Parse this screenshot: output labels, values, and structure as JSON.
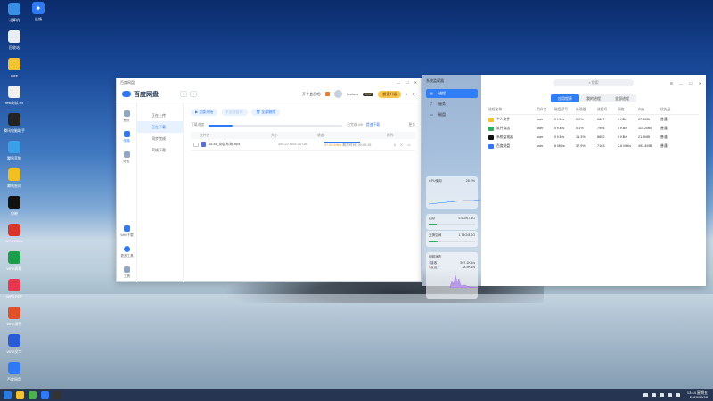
{
  "desktop": {
    "icons": [
      {
        "label": "计算机",
        "icon": "computer-icon",
        "color": "#3a8ee6"
      },
      {
        "label": "回收站",
        "icon": "trash-icon",
        "color": "#e8eef4"
      },
      {
        "label": "core",
        "icon": "folder-icon",
        "color": "#f2c230"
      },
      {
        "label": "test测试.txt",
        "icon": "text-file-icon",
        "color": "#f0f0f0"
      },
      {
        "label": "腾讯电脑助手",
        "icon": "qq-assistant-icon",
        "color": "#222222"
      },
      {
        "label": "腾讯蓝鲸",
        "icon": "ring-icon",
        "color": "#3aa0e8"
      },
      {
        "label": "腾讯智问",
        "icon": "lightbulb-icon",
        "color": "#f0c020"
      },
      {
        "label": "剪映",
        "icon": "capcut-icon",
        "color": "#111111"
      },
      {
        "label": "WPS Office",
        "icon": "wps-icon",
        "color": "#d9362b"
      },
      {
        "label": "WPS表格",
        "icon": "sheet-icon",
        "color": "#1a9e4c"
      },
      {
        "label": "WPS PDF",
        "icon": "pdf-icon",
        "color": "#e8364e"
      },
      {
        "label": "WPS演示",
        "icon": "slides-icon",
        "color": "#e0502b"
      },
      {
        "label": "WPS文字",
        "icon": "doc-icon",
        "color": "#2a5bd6"
      },
      {
        "label": "百度网盘",
        "icon": "cloud-icon",
        "color": "#2f79f5"
      }
    ],
    "icons_right": [
      {
        "label": "反馈",
        "icon": "bird-icon",
        "color": "#2f79f5"
      }
    ]
  },
  "taskbar": {
    "apps": [
      "launcher-icon",
      "cloud-icon",
      "files-icon",
      "monitor-icon",
      "terminal-icon"
    ],
    "app_colors": [
      "#2a7be0",
      "#f2c230",
      "#4caf50",
      "#2f79f5",
      "#333333"
    ],
    "time": "13:44 星期五",
    "date": "2025/08/08"
  },
  "baidu": {
    "title": "百度网盘",
    "logo": "百度网盘",
    "user_label": "开个会员吧!",
    "username": "tech••••",
    "vip": "SVIP",
    "upgrade": "超值升级",
    "left_nav": [
      {
        "label": "首页"
      },
      {
        "label": "传输"
      },
      {
        "label": "好友"
      }
    ],
    "left_bottom": [
      {
        "label": "Web下载"
      },
      {
        "label": "更多工具"
      },
      {
        "label": "工具"
      }
    ],
    "sub_nav": [
      "正在上传",
      "正在下载",
      "同步完成",
      "离线下载"
    ],
    "toolbar": {
      "start_all": "全部开始",
      "pause_all": "全部暂停",
      "delete_all": "全部删除"
    },
    "progress": {
      "label": "下载进度",
      "status": "已完成 4/5",
      "hint": "提速下载",
      "more": "更多",
      "fraction": 0.18
    },
    "table": {
      "headers": [
        "文件名",
        "大小",
        "状态",
        "操作"
      ],
      "rows": [
        {
          "name": "15-46_南部东海.mp4",
          "size": "309.22 KB/1.40 GB",
          "speed": "97.83 MB/s",
          "time": "剩余时间: 00:00:15"
        }
      ]
    }
  },
  "monitor": {
    "title": "系统监视器",
    "side": [
      {
        "label": "进程",
        "icon": "list-icon"
      },
      {
        "label": "服务",
        "icon": "service-icon"
      },
      {
        "label": "磁盘",
        "icon": "disk-icon"
      }
    ],
    "cards": [
      {
        "title": "CPU使用",
        "value": "26.2%"
      },
      {
        "title": "内存",
        "value": "9.5G/67.3G"
      },
      {
        "title": "交换空间",
        "value": "1.74G/8.0G"
      },
      {
        "title": "网络状态",
        "down": "507.1KB/s",
        "up": "38.9KB/s",
        "down_label": "接收",
        "up_label": "发送"
      }
    ],
    "search_placeholder": "搜索",
    "tabs": [
      "应用程序",
      "我的进程",
      "全部进程"
    ],
    "headers": [
      "进程名称",
      "用户名",
      "磁盘读写",
      "处理器",
      "进程号",
      "网络",
      "内存",
      "优先级"
    ],
    "rows": [
      {
        "name": "个人文件",
        "user": "user",
        "disk": "0 KB/s",
        "cpu": "0.0%",
        "pid": "6807",
        "net": "0 KB/s",
        "mem": "27.9MB",
        "prio": "普通",
        "color": "#f2c230"
      },
      {
        "name": "软件商店",
        "user": "user",
        "disk": "0 KB/s",
        "cpu": "0.1%",
        "pid": "7904",
        "net": "0 KB/s",
        "mem": "114.2MB",
        "prio": "普通",
        "color": "#2ab05a"
      },
      {
        "name": "系统监视器",
        "user": "user",
        "disk": "0 KB/s",
        "cpu": "15.3%",
        "pid": "8802",
        "net": "0 KB/s",
        "mem": "21.9MB",
        "prio": "普通",
        "color": "#111111"
      },
      {
        "name": "百度网盘",
        "user": "user",
        "disk": "6 MB/s",
        "cpu": "37.9%",
        "pid": "7163",
        "net": "2.6 MB/s",
        "mem": "492.4MB",
        "prio": "普通",
        "color": "#2f79f5"
      }
    ]
  }
}
